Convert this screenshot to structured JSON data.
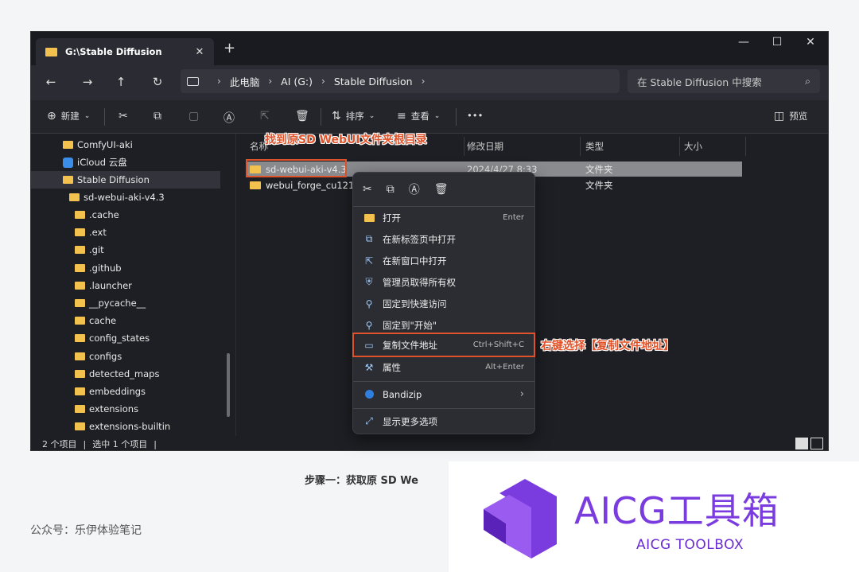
{
  "window": {
    "tab_title": "G:\\Stable Diffusion",
    "tab_close": "✕",
    "new_tab": "+",
    "minimize": "—",
    "maximize": "☐",
    "close": "✕"
  },
  "nav": {
    "back": "←",
    "forward": "→",
    "up": "↑",
    "refresh": "↻"
  },
  "breadcrumb": [
    "此电脑",
    "AI (G:)",
    "Stable Diffusion"
  ],
  "search": {
    "placeholder": "在 Stable Diffusion 中搜索",
    "icon": "⌕"
  },
  "toolbar": {
    "new_label": "新建",
    "sort_label": "排序",
    "view_label": "查看",
    "more": "•••",
    "preview_label": "预览"
  },
  "nav_pane": [
    {
      "label": "ComfyUI-aki",
      "icon": "folder"
    },
    {
      "label": "iCloud 云盘",
      "icon": "icloud"
    },
    {
      "label": "Stable Diffusion",
      "icon": "folder",
      "selected": true
    },
    {
      "label": "sd-webui-aki-v4.3",
      "icon": "folder"
    },
    {
      "label": ".cache",
      "icon": "folder"
    },
    {
      "label": ".ext",
      "icon": "folder"
    },
    {
      "label": ".git",
      "icon": "folder"
    },
    {
      "label": ".github",
      "icon": "folder"
    },
    {
      "label": ".launcher",
      "icon": "folder"
    },
    {
      "label": "__pycache__",
      "icon": "folder"
    },
    {
      "label": "cache",
      "icon": "folder"
    },
    {
      "label": "config_states",
      "icon": "folder"
    },
    {
      "label": "configs",
      "icon": "folder"
    },
    {
      "label": "detected_maps",
      "icon": "folder"
    },
    {
      "label": "embeddings",
      "icon": "folder"
    },
    {
      "label": "extensions",
      "icon": "folder"
    },
    {
      "label": "extensions-builtin",
      "icon": "folder"
    }
  ],
  "columns": [
    "名称",
    "修改日期",
    "类型",
    "大小"
  ],
  "files": [
    {
      "name": "sd-webui-aki-v4.3",
      "date": "2024/4/27 8:33",
      "type": "文件夹",
      "size": ""
    },
    {
      "name": "webui_forge_cu121_t",
      "date": "",
      "type": "文件夹",
      "size": ""
    }
  ],
  "status": {
    "items": "2 个项目",
    "selected": "选中 1 个项目",
    "divider": "|"
  },
  "context_menu": {
    "items": [
      {
        "label": "打开",
        "shortcut": "Enter",
        "icon": "open-folder-icon"
      },
      {
        "label": "在新标签页中打开",
        "shortcut": "",
        "icon": "new-tab-icon"
      },
      {
        "label": "在新窗口中打开",
        "shortcut": "",
        "icon": "new-window-icon"
      },
      {
        "label": "管理员取得所有权",
        "shortcut": "",
        "icon": "admin-icon"
      },
      {
        "label": "固定到快速访问",
        "shortcut": "",
        "icon": "pin-icon"
      },
      {
        "label": "固定到\"开始\"",
        "shortcut": "",
        "icon": "pin-icon"
      },
      {
        "label": "复制文件地址",
        "shortcut": "Ctrl+Shift+C",
        "icon": "copy-path-icon"
      },
      {
        "label": "属性",
        "shortcut": "Alt+Enter",
        "icon": "wrench-icon"
      },
      {
        "label": "Bandizip",
        "shortcut": "›",
        "icon": "bandizip-icon"
      },
      {
        "label": "显示更多选项",
        "shortcut": "",
        "icon": "more-options-icon"
      }
    ]
  },
  "annotations": {
    "find_root": "找到原SD WebUI文件夹根目录",
    "right_click": "右键选择【复制文件地址】"
  },
  "caption": "步骤一：获取原 SD We",
  "source": "公众号：乐伊体验笔记",
  "logo": {
    "title": "AICG工具箱",
    "subtitle": "AICG TOOLBOX",
    "color": "#7b3cdf"
  }
}
